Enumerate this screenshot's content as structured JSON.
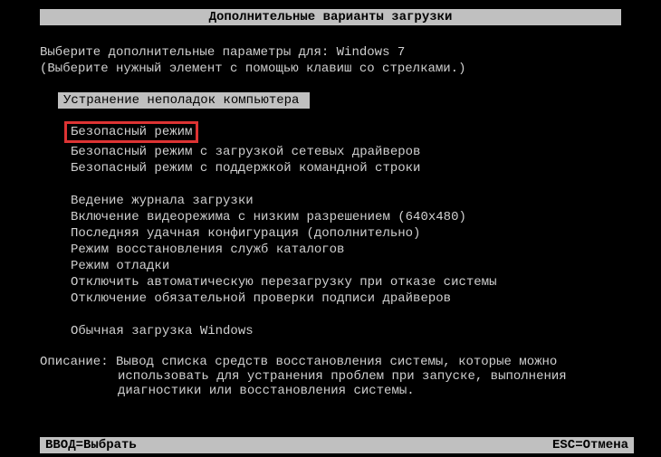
{
  "title": "Дополнительные варианты загрузки",
  "instruction": {
    "line1_prefix": "Выберите дополнительные параметры для: ",
    "os_name": "Windows 7",
    "line2": "(Выберите нужный элемент с помощью клавиш со стрелками.)"
  },
  "selected_option": "Устранение неполадок компьютера",
  "menu": {
    "group1": [
      "Безопасный режим",
      "Безопасный режим с загрузкой сетевых драйверов",
      "Безопасный режим с поддержкой командной строки"
    ],
    "group2": [
      "Ведение журнала загрузки",
      "Включение видеорежима с низким разрешением (640x480)",
      "Последняя удачная конфигурация (дополнительно)",
      "Режим восстановления служб каталогов",
      "Режим отладки",
      "Отключить автоматическую перезагрузку при отказе системы",
      "Отключение обязательной проверки подписи драйверов"
    ],
    "group3": [
      "Обычная загрузка Windows"
    ]
  },
  "description": {
    "label": "Описание: ",
    "line1": "Вывод списка средств восстановления системы, которые можно",
    "line2": "использовать для устранения проблем при запуске, выполнения",
    "line3": "диагностики или восстановления системы."
  },
  "footer": {
    "enter": "ВВОД=Выбрать",
    "esc": "ESC=Отмена"
  }
}
